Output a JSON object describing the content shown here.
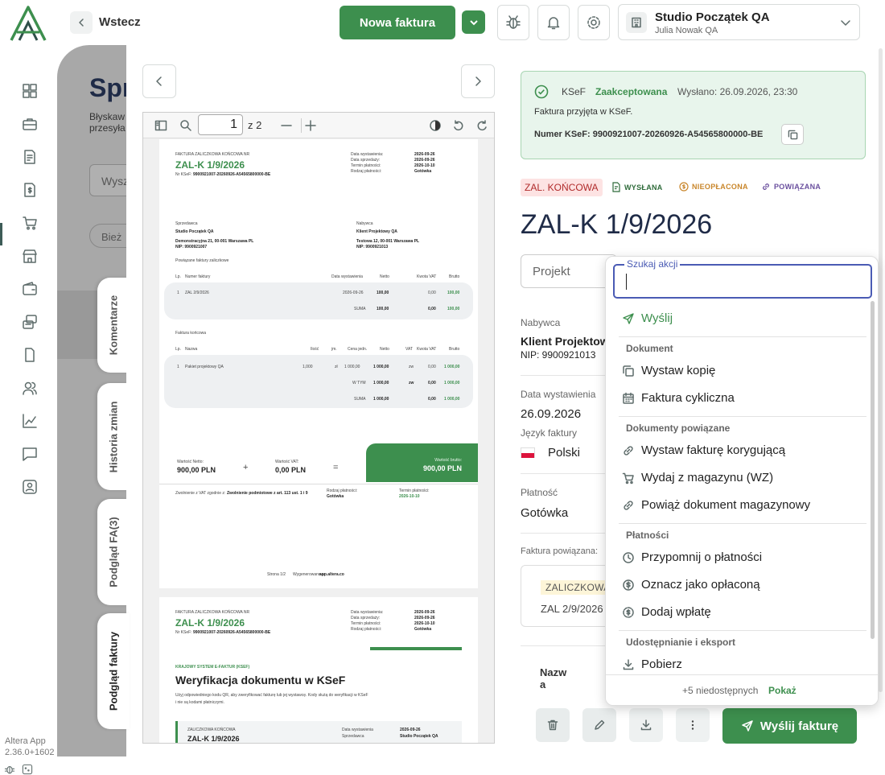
{
  "header": {
    "back_label": "Wstecz",
    "new_invoice_label": "Nowa faktura",
    "company_name": "Studio Początek QA",
    "company_user": "Julia Nowak QA"
  },
  "sidebar": {
    "icons": [
      "dashboard-icon",
      "briefcase-icon",
      "invoice-list-icon",
      "money-document-icon",
      "cart-icon",
      "store-icon",
      "wallet-icon",
      "transfer-icon",
      "document-icon",
      "users-icon",
      "chart-icon",
      "chat-icon",
      "contact-icon"
    ],
    "active_index": 3
  },
  "app": {
    "name": "Altera App",
    "version": "2.36.0+1602"
  },
  "background": {
    "title": "Spr",
    "subtitle_line1": "Błyskaw",
    "subtitle_line2": "przesyła",
    "search_placeholder": "Wysz",
    "chip_label": "Bież"
  },
  "side_tabs": [
    "Komentarze",
    "Historia zmian",
    "Podgląd FA(3)",
    "Podgląd faktury"
  ],
  "pdf": {
    "page_input": "1",
    "page_of": "z 2",
    "page1": {
      "doc_type": "FAKTURA ZALICZKOWA KOŃCOWA NR",
      "number": "ZAL-K 1/9/2026",
      "ksef_label": "Nr KSeF:",
      "ksef_no": "9900921007-20260926-A54565800000-BE",
      "meta_labels": [
        "Data wystawienia:",
        "Data sprzedaży:",
        "Termin płatności:",
        "Rodzaj płatności:"
      ],
      "meta_values": [
        "2026-09-26",
        "2026-09-26",
        "2026-10-10",
        "Gotówka"
      ],
      "seller_label": "Sprzedawca",
      "seller_name": "Studio Początek QA",
      "seller_addr": "Demonstracyjna 21, 00-001 Warszawa PL",
      "seller_nip": "NIP: 9900921007",
      "buyer_label": "Nabywca",
      "buyer_name": "Klient Projektowy QA",
      "buyer_addr": "Testowa 12, 00-001 Warszawa PL",
      "buyer_nip": "NIP: 9900921013",
      "linked_title": "Powiązane faktury zaliczkowe",
      "linked_headers": [
        "Lp.",
        "Numer faktury",
        "Data wystawienia",
        "Netto",
        "Kwota VAT",
        "Brutto"
      ],
      "linked_row": [
        "1",
        "ZAL 2/9/2026",
        "2026-09-26",
        "100,00",
        "0,00",
        "100,00"
      ],
      "linked_sum": [
        "SUMA",
        "100,00",
        "0,00",
        "100,00"
      ],
      "final_title": "Faktura końcowa",
      "final_headers": [
        "Lp.",
        "Nazwa",
        "Ilość",
        "jm.",
        "Cena jedn.",
        "Netto",
        "VAT",
        "Kwota VAT",
        "Brutto"
      ],
      "final_row": [
        "1",
        "Pakiet projektowy QA",
        "1,000",
        "zł",
        "1 000,00",
        "1 000,00",
        "zw",
        "0,00",
        "1 000,00"
      ],
      "wtym": [
        "W TYM",
        "1 000,00",
        "zw",
        "0,00",
        "1 000,00"
      ],
      "final_sum": [
        "SUMA",
        "1 000,00",
        "0,00",
        "1 000,00"
      ],
      "net_label": "Wartość Netto:",
      "net_value": "900,00 PLN",
      "vat_label": "Wartość VAT:",
      "vat_value": "0,00 PLN",
      "gross_label": "Wartość brutto:",
      "gross_value": "900,00 PLN",
      "plus": "+",
      "equals": "=",
      "exempt_note_prefix": "Zwolnienie z VAT zgodnie z:",
      "exempt_note_value": "Zwolnienie podmiotowe z art. 113 ust. 1 i 9",
      "pay_kind_label": "Rodzaj płatności:",
      "pay_kind_value": "Gotówka",
      "pay_term_label": "Termin płatności:",
      "pay_term_value": "2026-10-10",
      "footer_page": "Strona 1/2",
      "footer_made": "Wygenerowano w",
      "footer_site": "app.altera.co"
    },
    "page2": {
      "ksef_section": "KRAJOWY SYSTEM E-FAKTUR (KSEF)",
      "verify_title": "Weryfikacja dokumentu w KSeF",
      "verify_text1": "Użyj odpowiedniego kodu QR, aby zweryfikować fakturę lub jej wystawcę. Kody służą do weryfikacji w KSeF",
      "verify_text2": "i nie są kodami płatniczymi.",
      "box_label": "ZALICZKOWA KOŃCOWA",
      "box_number": "ZAL-K 1/9/2026",
      "box_meta_labels": [
        "Data wystawienia",
        "Sprzedawca"
      ],
      "box_meta_values": [
        "2026-09-26",
        "Studio Początek QA"
      ]
    }
  },
  "ksef_panel": {
    "label": "KSeF",
    "status": "Zaakceptowana",
    "sent": "Wysłano: 26.09.2026, 23:30",
    "message": "Faktura przyjęta w KSeF.",
    "number_line": "Numer KSeF: 9900921007-20260926-A54565800000-BE"
  },
  "badges": {
    "type": "ZAL. KOŃCOWA",
    "sent": "WYSŁANA",
    "unpaid": "NIEOPŁACONA",
    "linked": "POWIĄZANA"
  },
  "invoice": {
    "number": "ZAL-K 1/9/2026",
    "project_placeholder": "Projekt",
    "buyer_label": "Nabywca",
    "buyer_name": "Klient Projektowy",
    "buyer_nip": "NIP: 9900921013",
    "issue_label": "Data wystawienia",
    "issue_date": "26.09.2026",
    "lang_label": "Język faktury",
    "lang_value": "Polski",
    "payment_label": "Płatność",
    "payment_value": "Gotówka",
    "related_label": "Faktura powiązana:",
    "related_badge": "ZALICZKOWA",
    "related_no": "ZAL 2/9/2026",
    "name_label_1": "Nazw",
    "name_label_2": "a",
    "send_label": "Wyślij fakturę"
  },
  "actions_menu": {
    "search_label": "Szukaj akcji",
    "search_value": "",
    "send": "Wyślij",
    "section_document": "Dokument",
    "copy": "Wystaw kopię",
    "recurring": "Faktura cykliczna",
    "section_related": "Dokumenty powiązane",
    "correction": "Wystaw fakturę korygującą",
    "warehouse": "Wydaj z magazynu (WZ)",
    "link_doc": "Powiąż dokument magazynowy",
    "section_payments": "Płatności",
    "remind": "Przypomnij o płatności",
    "mark_paid": "Oznacz jako opłaconą",
    "add_payment": "Dodaj wpłatę",
    "section_share": "Udostępnianie i eksport",
    "download": "Pobierz",
    "unavailable": "+5 niedostępnych",
    "show": "Pokaż"
  },
  "colors": {
    "brand_green": "#3d8f4e",
    "navy": "#1f2b47",
    "focus_blue": "#4a5bb4",
    "status_red": "#b02a2a",
    "status_orange": "#c9862b",
    "status_purple": "#6a4f9e"
  }
}
